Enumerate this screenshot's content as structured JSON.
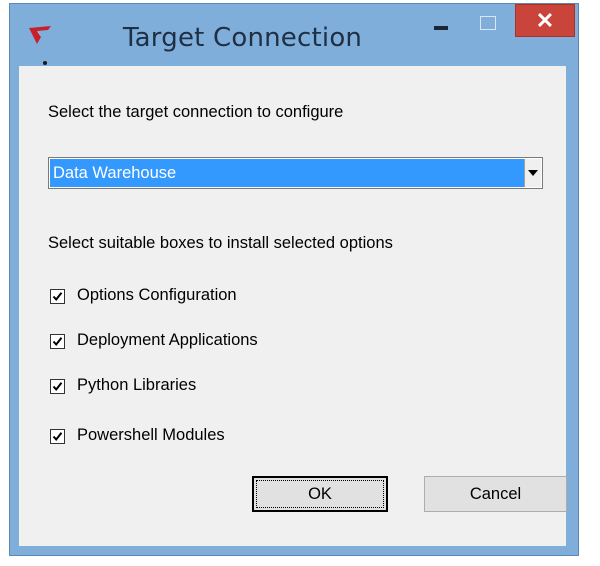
{
  "window": {
    "title": "Target Connection",
    "close_glyph": "✕",
    "colors": {
      "frame": "#7faedb",
      "close": "#c9443a",
      "selection": "#3399ff",
      "client": "#f0f0f0"
    }
  },
  "icons": {
    "app": "app-logo-icon",
    "minimize": "minimize-icon",
    "maximize": "maximize-icon",
    "close": "close-icon",
    "dropdown": "chevron-down-icon",
    "check": "checkmark-icon"
  },
  "form": {
    "connection_prompt": "Select the target connection to configure",
    "connection_selected": "Data Warehouse",
    "options_prompt": "Select suitable boxes to install selected options",
    "options": [
      {
        "label": "Options Configuration",
        "checked": true
      },
      {
        "label": "Deployment Applications",
        "checked": true
      },
      {
        "label": "Python Libraries",
        "checked": true
      },
      {
        "label": "Powershell Modules",
        "checked": true
      }
    ]
  },
  "buttons": {
    "ok": "OK",
    "cancel": "Cancel"
  }
}
